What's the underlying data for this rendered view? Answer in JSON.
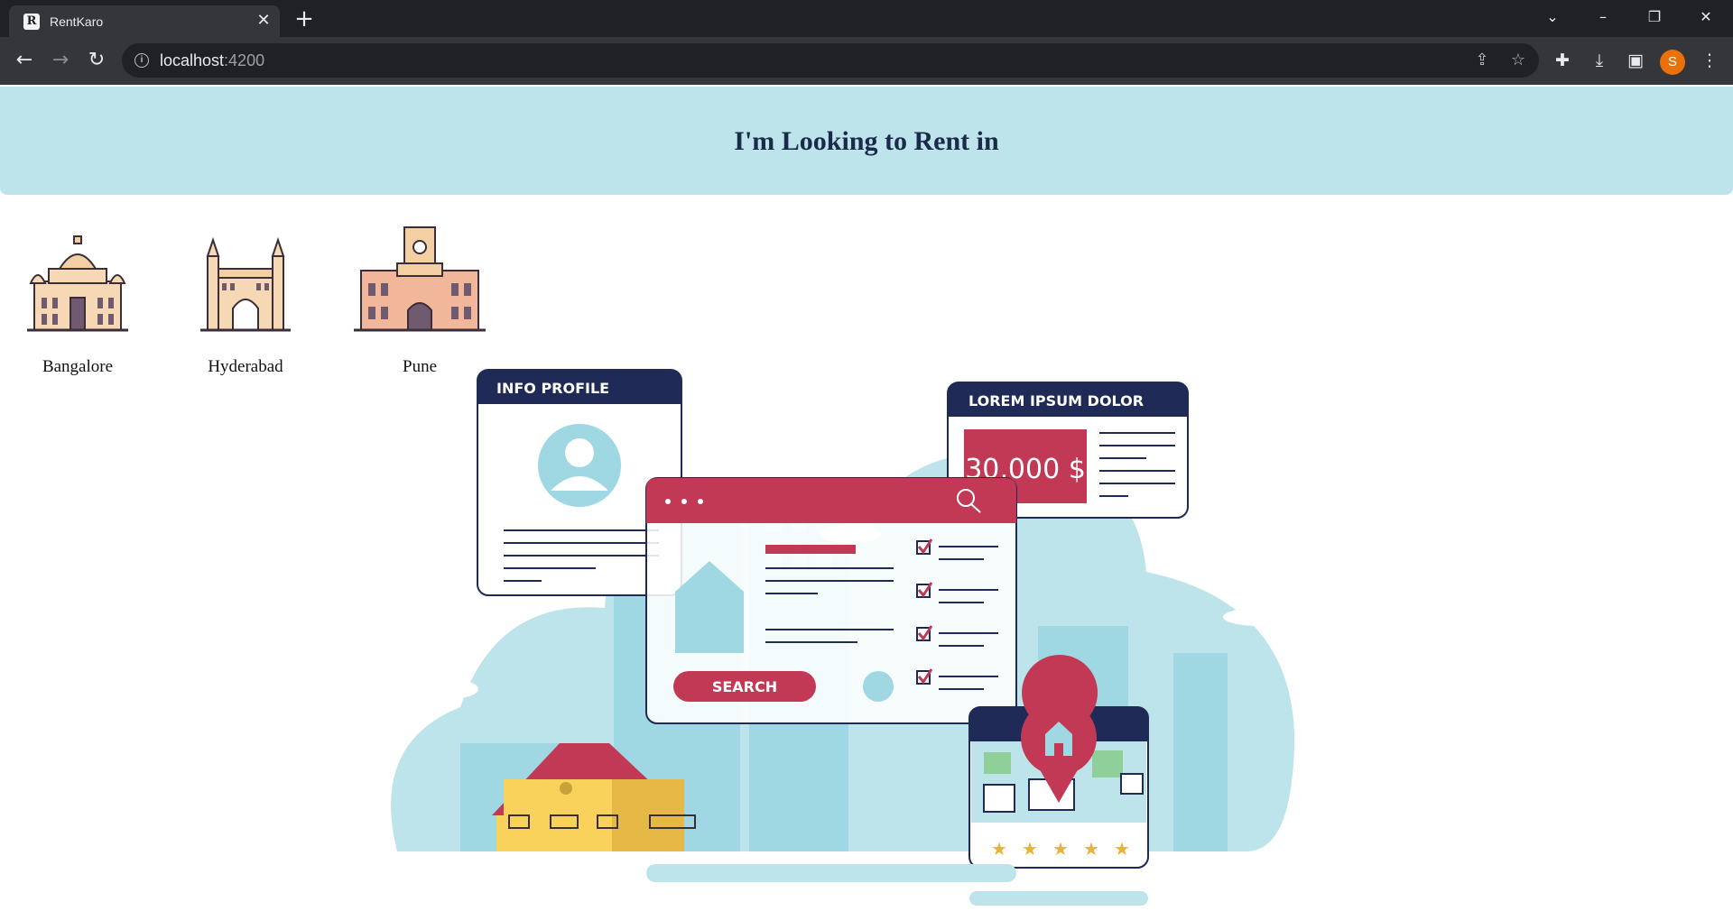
{
  "browser": {
    "tab_title": "RentKaro",
    "tab_favicon": "R",
    "url_host": "localhost",
    "url_port": ":4200",
    "avatar_initial": "S",
    "icons": [
      "back-arrow-icon",
      "forward-arrow-icon",
      "reload-icon",
      "site-info-icon",
      "share-icon",
      "bookmark-star-icon",
      "extensions-icon",
      "download-icon",
      "side-panel-icon",
      "more-menu-icon"
    ]
  },
  "page": {
    "title": "I'm Looking to Rent in"
  },
  "cities": [
    {
      "label": "Bangalore",
      "icon": "vidhana-soudha-icon"
    },
    {
      "label": "Hyderabad",
      "icon": "charminar-icon"
    },
    {
      "label": "Pune",
      "icon": "pune-landmark-icon"
    }
  ],
  "illustration": {
    "info_card_title": "INFO PROFILE",
    "price_card_title": "LOREM IPSUM DOLOR",
    "price": "30,000 $",
    "search_label": "SEARCH",
    "rating_stars": 5,
    "colors": {
      "navy": "#1f2a56",
      "crimson": "#c23955",
      "light_blue": "#bde4ea",
      "mid_blue": "#9fd8e3",
      "house_yellow": "#f8d25a"
    }
  }
}
